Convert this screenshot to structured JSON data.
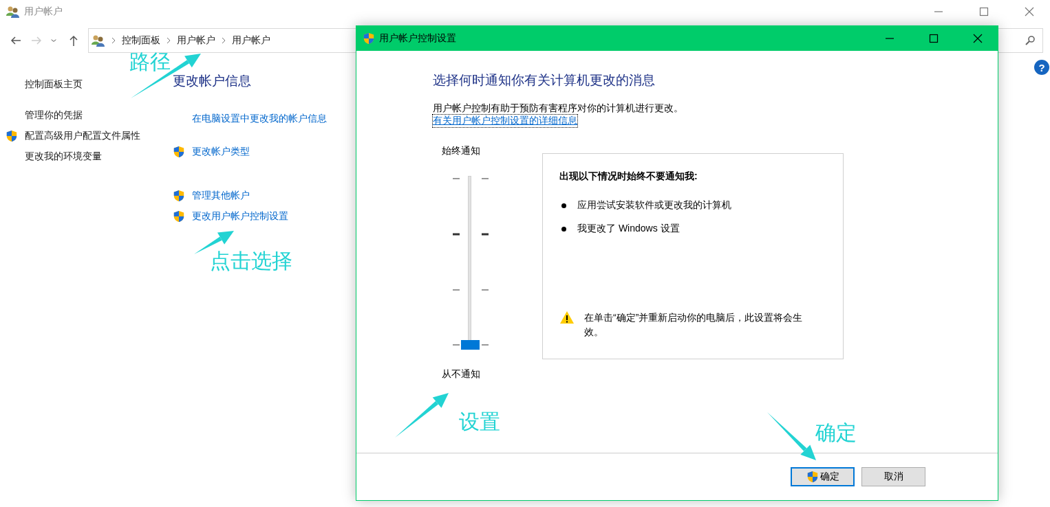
{
  "window": {
    "title": "用户帐户",
    "breadcrumb": [
      "控制面板",
      "用户帐户",
      "用户帐户"
    ],
    "help": "?"
  },
  "sidebar": {
    "items": [
      {
        "label": "控制面板主页",
        "shield": false
      },
      {
        "label": "管理你的凭据",
        "shield": false
      },
      {
        "label": "配置高级用户配置文件属性",
        "shield": true
      },
      {
        "label": "更改我的环境变量",
        "shield": false
      }
    ]
  },
  "main": {
    "heading": "更改帐户信息",
    "links": [
      {
        "label": "在电脑设置中更改我的帐户信息",
        "shield": false
      },
      {
        "label": "更改帐户类型",
        "shield": true
      },
      {
        "label": "管理其他帐户",
        "shield": true
      },
      {
        "label": "更改用户帐户控制设置",
        "shield": true
      }
    ]
  },
  "dialog": {
    "title": "用户帐户控制设置",
    "heading": "选择何时通知你有关计算机更改的消息",
    "description": "用户帐户控制有助于预防有害程序对你的计算机进行更改。",
    "link": "有关用户帐户控制设置的详细信息",
    "slider": {
      "top_label": "始终通知",
      "bottom_label": "从不通知",
      "level": 0
    },
    "info": {
      "title": "出现以下情况时始终不要通知我:",
      "bullets": [
        "应用尝试安装软件或更改我的计算机",
        "我更改了 Windows 设置"
      ],
      "warning": "在单击“确定”并重新启动你的电脑后，此设置将会生效。"
    },
    "buttons": [
      {
        "label": "确定",
        "shield": true,
        "default": true
      },
      {
        "label": "取消",
        "shield": false,
        "default": false
      }
    ]
  },
  "annotations": [
    "路径",
    "点击选择",
    "设置",
    "确定"
  ]
}
